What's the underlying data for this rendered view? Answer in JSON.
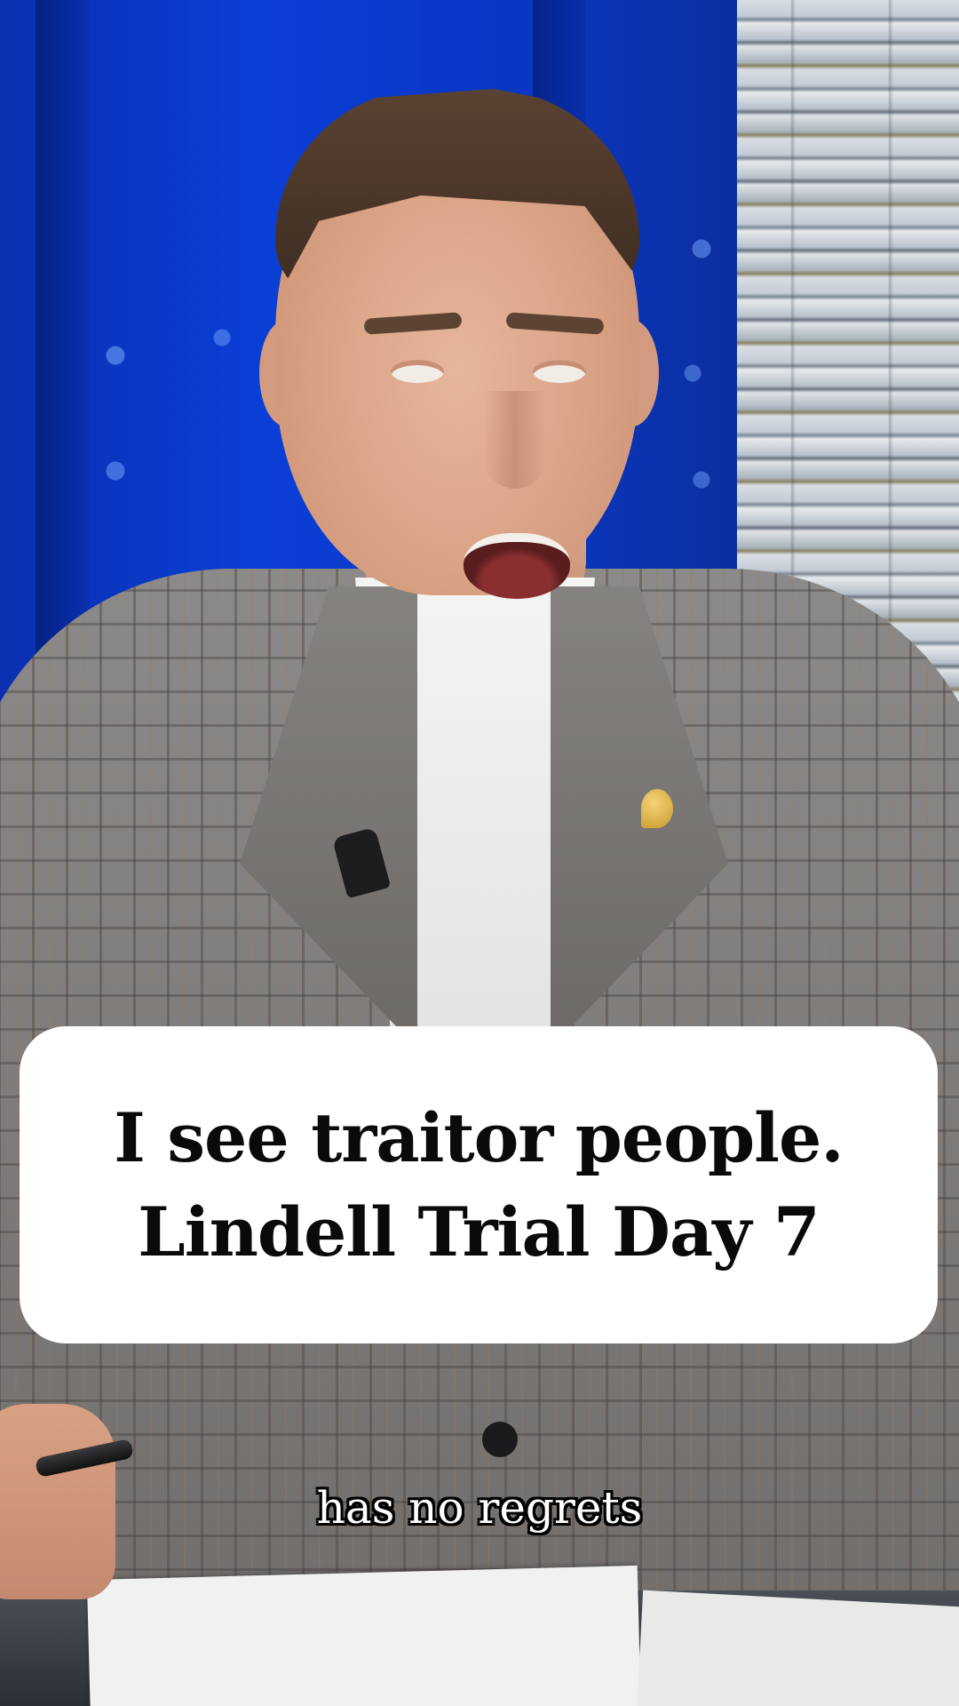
{
  "caption": {
    "line_1": "I see traitor people.",
    "line_2": "Lindell Trial Day 7"
  },
  "subtitle": {
    "text": "has no regrets"
  },
  "colors": {
    "studio_background": "#0a3fd6",
    "caption_card": "#ffffff",
    "caption_text": "#0a0a0a",
    "subtitle_text": "#ffffff",
    "subtitle_outline": "#000000"
  }
}
